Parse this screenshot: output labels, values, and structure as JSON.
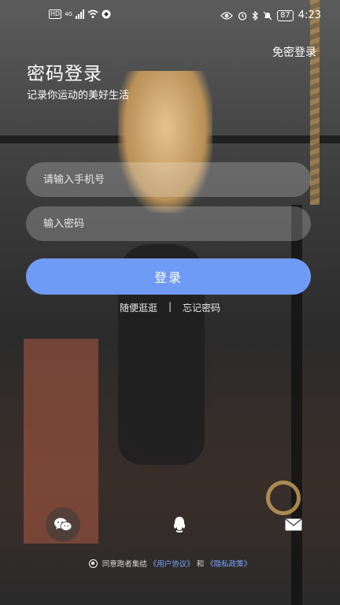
{
  "status_bar": {
    "hd_label": "HD",
    "network_label": "4G",
    "battery": "87",
    "time": "4:23"
  },
  "header": {
    "skip_login": "免密登录",
    "title": "密码登录",
    "subtitle": "记录你运动的美好生活"
  },
  "form": {
    "phone_placeholder": "请输入手机号",
    "password_placeholder": "输入密码",
    "login_label": "登录"
  },
  "links": {
    "browse": "随便逛逛",
    "separator": "|",
    "forgot": "忘记密码"
  },
  "social": {
    "icons": [
      "wechat-icon",
      "qq-icon",
      "mail-icon"
    ]
  },
  "agreement": {
    "prefix": "同意跑者集结",
    "user_agreement": "《用户协议》",
    "and": "和",
    "privacy_policy": "《隐私政策》"
  },
  "colors": {
    "accent": "#6f9bf7",
    "link_blue": "#7aa5ff"
  }
}
